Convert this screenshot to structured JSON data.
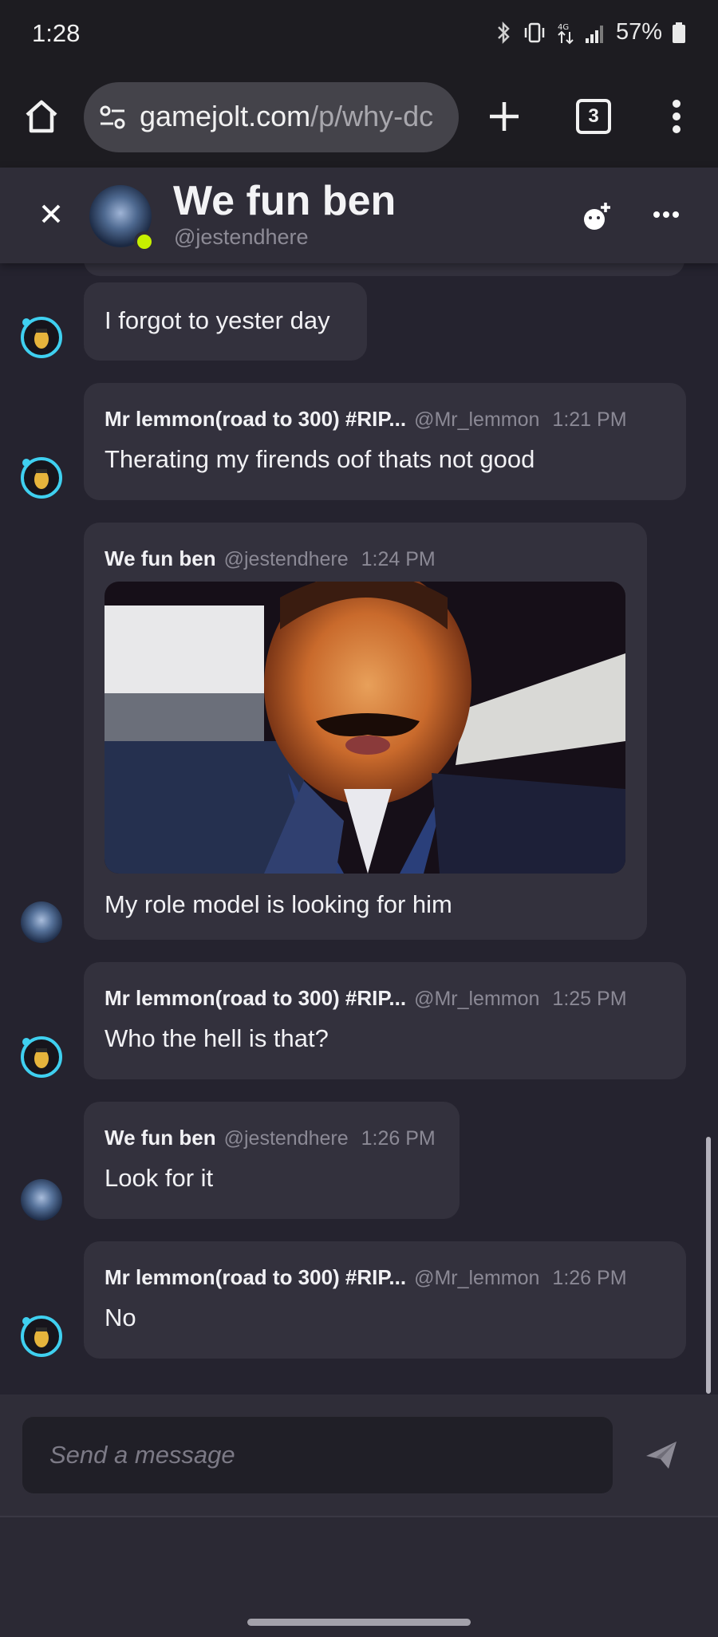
{
  "status_bar": {
    "time": "1:28",
    "battery": "57%",
    "icons": [
      "bluetooth-icon",
      "vibrate-icon",
      "data-arrows-icon",
      "signal-icon",
      "battery-icon"
    ]
  },
  "browser": {
    "url_host": "gamejolt.com",
    "url_path": "/p/why-dc",
    "tab_count": "3",
    "icons": [
      "home-icon",
      "site-settings-icon",
      "plus-icon",
      "more-vert-icon"
    ]
  },
  "chat_header": {
    "title": "We fun ben",
    "handle": "@jestendhere",
    "online_color": "#c6f000",
    "icons": [
      "close-icon",
      "add-friend-icon",
      "more-horiz-icon"
    ]
  },
  "messages": [
    {
      "name": "",
      "handle": "",
      "time": "",
      "text": "I forgot to yester day",
      "author": "lemmon"
    },
    {
      "name": "Mr lemmon(road to 300) #RIP...",
      "handle": "@Mr_lemmon",
      "time": "1:21 PM",
      "text": "Therating my firends oof thats not good",
      "author": "lemmon"
    },
    {
      "name": "We fun ben",
      "handle": "@jestendhere",
      "time": "1:24 PM",
      "text": "My role model is looking for him",
      "author": "ben",
      "has_image": true
    },
    {
      "name": "Mr lemmon(road to 300) #RIP...",
      "handle": "@Mr_lemmon",
      "time": "1:25 PM",
      "text": "Who the hell is that?",
      "author": "lemmon"
    },
    {
      "name": "We fun ben",
      "handle": "@jestendhere",
      "time": "1:26 PM",
      "text": "Look for it",
      "author": "ben"
    },
    {
      "name": "Mr lemmon(road to 300) #RIP...",
      "handle": "@Mr_lemmon",
      "time": "1:26 PM",
      "text": "No",
      "author": "lemmon"
    }
  ],
  "composer": {
    "placeholder": "Send a message",
    "icons": [
      "send-icon"
    ]
  },
  "colors": {
    "background": "#25232f",
    "bubble": "#33313d",
    "header": "#2f2d38",
    "avatar_ring": "#3fd0f0"
  }
}
